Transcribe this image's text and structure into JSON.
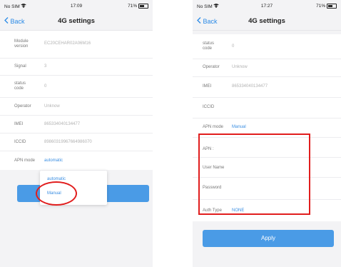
{
  "left_screen": {
    "status_bar": {
      "carrier": "No SIM",
      "time": "17:09",
      "battery": "71%"
    },
    "nav": {
      "back_label": "Back",
      "title": "4G settings"
    },
    "rows": [
      {
        "label": "Module version",
        "value": "EC20CEHAR02A06M16"
      },
      {
        "label": "Signal",
        "value": "3"
      },
      {
        "label": "status code",
        "value": "0"
      },
      {
        "label": "Operator",
        "value": "Unknow"
      },
      {
        "label": "IMEI",
        "value": "865334040134477"
      },
      {
        "label": "ICCID",
        "value": "89860319967664986070"
      },
      {
        "label": "APN mode",
        "value": "automatic"
      }
    ],
    "dropdown": {
      "options": [
        "automatic",
        "Manual"
      ],
      "highlighted": "Manual"
    }
  },
  "right_screen": {
    "status_bar": {
      "carrier": "No SIM",
      "time": "17:27",
      "battery": "71%"
    },
    "nav": {
      "back_label": "Back",
      "title": "4G settings"
    },
    "rows": [
      {
        "label": "status code",
        "value": "0"
      },
      {
        "label": "Operator",
        "value": "Unknow"
      },
      {
        "label": "IMEI",
        "value": "865334040134477"
      },
      {
        "label": "ICCID",
        "value": ""
      },
      {
        "label": "APN mode",
        "value": "Manual"
      },
      {
        "label": "APN :",
        "value": ""
      },
      {
        "label": "User Name",
        "value": ""
      },
      {
        "label": "Password",
        "value": ""
      },
      {
        "label": "Auth Type",
        "value": "NONE"
      }
    ],
    "apply_label": "Apply"
  },
  "colors": {
    "accent": "#3a8ee2",
    "button": "#4a9be6",
    "annotation": "#e11d1d"
  },
  "icons": {
    "back": "chevron-left-icon",
    "wifi": "wifi-icon",
    "battery": "battery-icon"
  }
}
